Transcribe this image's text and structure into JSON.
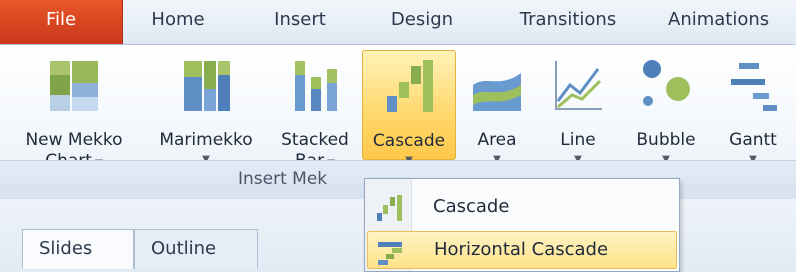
{
  "tabs": [
    "File",
    "Home",
    "Insert",
    "Design",
    "Transitions",
    "Animations"
  ],
  "ribbon": {
    "group_label": "Insert Mek",
    "buttons": [
      {
        "line1": "New Mekko",
        "line2": "Chart",
        "icon": "mekko-chart-icon"
      },
      {
        "line1": "Marimekko",
        "line2": "",
        "icon": "marimekko-icon"
      },
      {
        "line1": "Stacked",
        "line2": "Bar",
        "icon": "stacked-bar-icon"
      },
      {
        "line1": "Cascade",
        "line2": "",
        "icon": "cascade-icon"
      },
      {
        "line1": "Area",
        "line2": "",
        "icon": "area-chart-icon"
      },
      {
        "line1": "Line",
        "line2": "",
        "icon": "line-chart-icon"
      },
      {
        "line1": "Bubble",
        "line2": "",
        "icon": "bubble-chart-icon"
      },
      {
        "line1": "Gantt",
        "line2": "",
        "icon": "gantt-chart-icon"
      }
    ]
  },
  "menu": {
    "items": [
      {
        "label": "Cascade",
        "icon": "cascade-icon"
      },
      {
        "label": "Horizontal Cascade",
        "icon": "horizontal-cascade-icon",
        "highlighted": true
      }
    ]
  },
  "panel_tabs": [
    "Slides",
    "Outline"
  ],
  "colors": {
    "file_tab": "#d9471f",
    "active_button": "#ffd76a",
    "highlight": "#ffe28a"
  }
}
